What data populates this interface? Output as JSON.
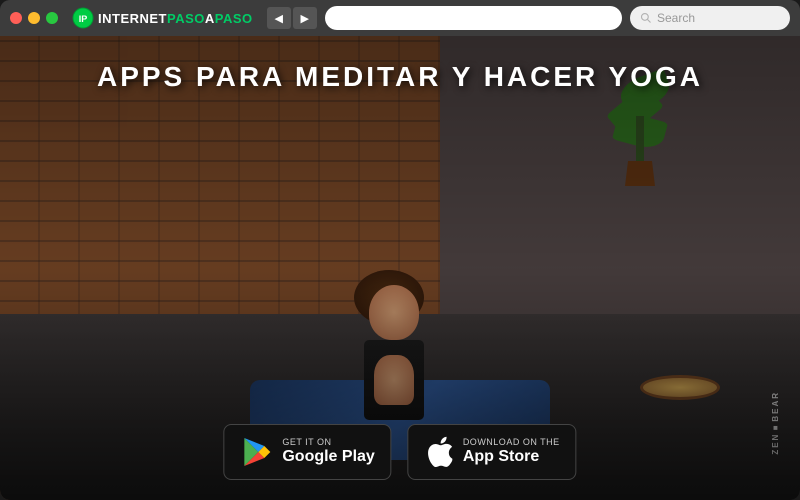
{
  "browser": {
    "title": "Apps para Meditar y Hacer Yoga",
    "search_placeholder": "Search",
    "back_label": "◀",
    "forward_label": "▶"
  },
  "logo": {
    "prefix": "INTERNET",
    "suffix1": "PASO",
    "separator": "A",
    "suffix2": "PASO"
  },
  "hero": {
    "title": "APPS PARA MEDITAR Y HACER YOGA"
  },
  "app_buttons": {
    "google_play": {
      "small_text": "GET IT ON",
      "large_text": "Google Play"
    },
    "app_store": {
      "small_text": "Download on the",
      "large_text": "App Store"
    }
  },
  "zen_bear": "ZEN■BEAR"
}
